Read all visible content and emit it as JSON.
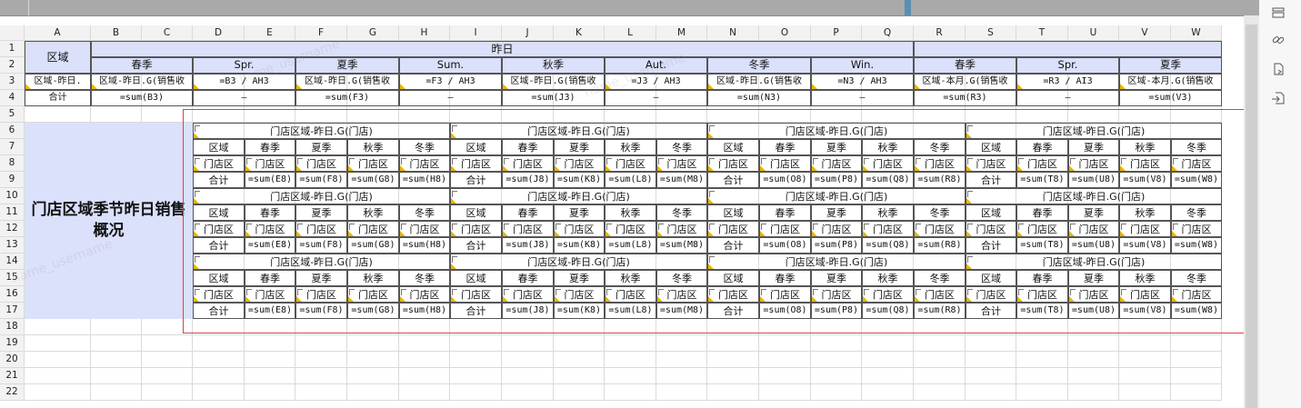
{
  "col_letters": [
    "A",
    "B",
    "C",
    "D",
    "E",
    "F",
    "G",
    "H",
    "I",
    "J",
    "K",
    "L",
    "M",
    "N",
    "O",
    "P",
    "Q",
    "R",
    "S",
    "T",
    "U",
    "V",
    "W"
  ],
  "row_numbers": [
    "1",
    "2",
    "3",
    "4",
    "5",
    "6",
    "7",
    "8",
    "9",
    "10",
    "11",
    "12",
    "13",
    "14",
    "15",
    "16",
    "17",
    "18",
    "19",
    "20",
    "21",
    "22"
  ],
  "top": {
    "region_header": "区域",
    "yesterday_header": "昨日",
    "seasons": [
      "春季",
      "Spr.",
      "夏季",
      "Sum.",
      "秋季",
      "Aut.",
      "冬季",
      "Win.",
      "春季",
      "Spr.",
      "夏季"
    ],
    "row3": [
      "区域-昨日.",
      "区域-昨日.G(销售收",
      "=B3 / AH3",
      "区域-昨日.G(销售收",
      "=F3 / AH3",
      "区域-昨日.G(销售收",
      "=J3 / AH3",
      "区域-昨日.G(销售收",
      "=N3 / AH3",
      "区域-本月.G(销售收",
      "=R3 / AI3",
      "区域-本月.G(销售收"
    ],
    "row4": [
      "合计",
      "=sum(B3)",
      "—",
      "=sum(F3)",
      "—",
      "=sum(J3)",
      "—",
      "=sum(N3)",
      "—",
      "=sum(R3)",
      "—",
      "=sum(V3)"
    ]
  },
  "side_title": "门店区域季节昨日销售概况",
  "block_title": "门店区域-昨日.G(门店)",
  "block_header": [
    "区域",
    "春季",
    "夏季",
    "秋季",
    "冬季"
  ],
  "block_store": "门店区",
  "block_total": "合计",
  "block_sums": [
    [
      "=sum(E8)",
      "=sum(F8)",
      "=sum(G8)",
      "=sum(H8)"
    ],
    [
      "=sum(J8)",
      "=sum(K8)",
      "=sum(L8)",
      "=sum(M8)"
    ],
    [
      "=sum(O8)",
      "=sum(P8)",
      "=sum(Q8)",
      "=sum(R8)"
    ],
    [
      "=sum(T8)",
      "=sum(U8)",
      "=sum(V8)",
      "=sum(W8)"
    ]
  ],
  "watermark": "name_username"
}
